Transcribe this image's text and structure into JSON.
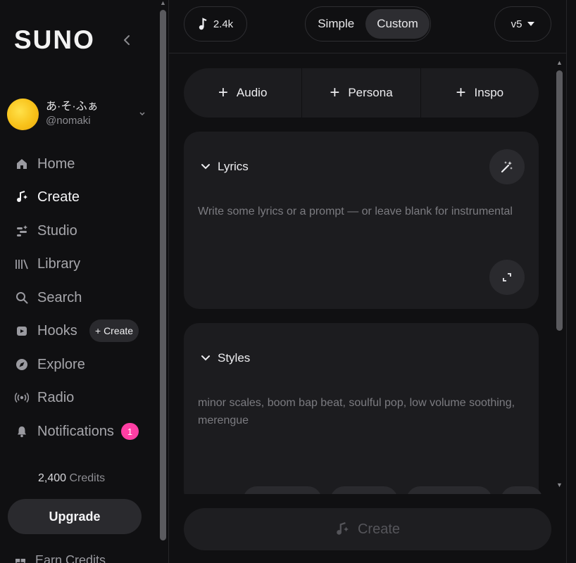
{
  "sidebar": {
    "logo": "SUNO",
    "profile": {
      "name": "あ·そ·ふぁ",
      "handle": "@nomaki"
    },
    "nav": [
      {
        "label": "Home",
        "icon": "home-icon"
      },
      {
        "label": "Create",
        "icon": "create-music-icon",
        "active": true
      },
      {
        "label": "Studio",
        "icon": "studio-icon"
      },
      {
        "label": "Library",
        "icon": "library-icon"
      },
      {
        "label": "Search",
        "icon": "search-icon"
      },
      {
        "label": "Hooks",
        "icon": "hooks-icon"
      },
      {
        "label": "Explore",
        "icon": "compass-icon"
      },
      {
        "label": "Radio",
        "icon": "radio-icon"
      },
      {
        "label": "Notifications",
        "icon": "bell-icon"
      }
    ],
    "hooks_create_label": "+ Create",
    "notifications_badge": "1",
    "credits_amount": "2,400",
    "credits_label": "Credits",
    "upgrade_label": "Upgrade",
    "earn_label": "Earn Credits"
  },
  "topbar": {
    "credits": "2.4k",
    "modes": [
      "Simple",
      "Custom"
    ],
    "selected_mode": "Custom",
    "version": "v5"
  },
  "add_buttons": [
    "Audio",
    "Persona",
    "Inspo"
  ],
  "lyrics": {
    "title": "Lyrics",
    "placeholder": "Write some lyrics or a prompt — or leave blank for instrumental"
  },
  "styles": {
    "title": "Styles",
    "placeholder": "minor scales, boom bap beat, soulful pop, low volume soothing, merengue"
  },
  "create_label": "Create",
  "colors": {
    "accent_badge": "#ff3fa4",
    "background": "#101012",
    "card": "#1c1c1f"
  }
}
